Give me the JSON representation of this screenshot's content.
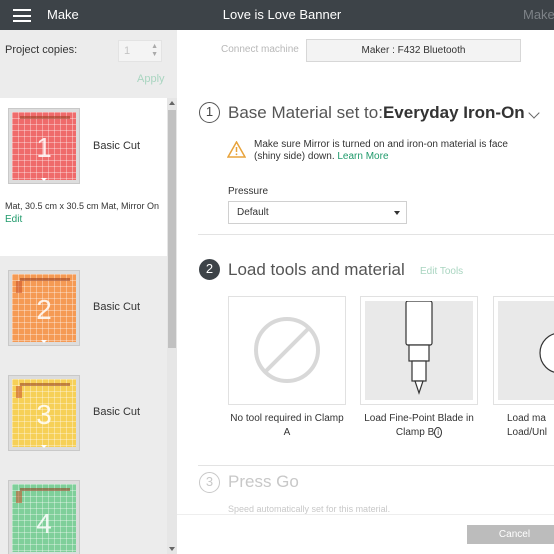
{
  "topbar": {
    "make_label": "Make",
    "title": "Love is Love Banner",
    "right_label": "Maker"
  },
  "sidebar": {
    "copies_label": "Project copies:",
    "copies_value": "1",
    "apply_label": "Apply",
    "mats": [
      {
        "number": "1",
        "color": "#ef6b6b",
        "label": "Basic Cut",
        "desc": "Mat, 30.5 cm x 30.5 cm Mat, Mirror On",
        "edit": "Edit"
      },
      {
        "number": "2",
        "color": "#f59a54",
        "label": "Basic Cut"
      },
      {
        "number": "3",
        "color": "#f6d057",
        "label": "Basic Cut"
      },
      {
        "number": "4",
        "color": "#7fcf9a",
        "label": ""
      }
    ]
  },
  "main": {
    "connect_label": "Connect machine",
    "machine_label": "Maker : F432 Bluetooth",
    "step1": {
      "number": "1",
      "title_prefix": "Base Material set to:",
      "title_material": "Everyday Iron-On"
    },
    "warning": {
      "text": "Make sure Mirror is turned on and iron-on material is face (shiny side) down.",
      "link": "Learn More"
    },
    "pressure": {
      "label": "Pressure",
      "value": "Default"
    },
    "step2": {
      "number": "2",
      "title": "Load tools and material",
      "edit_tools": "Edit Tools"
    },
    "tools": [
      {
        "caption": "No tool required in Clamp A"
      },
      {
        "caption": "Load Fine-Point Blade in Clamp B"
      },
      {
        "caption": "Load ma Load/Unl"
      }
    ],
    "step3": {
      "number": "3",
      "title": "Press Go",
      "desc": "Speed automatically set for this material."
    }
  },
  "footer": {
    "cancel_label": "Cancel"
  },
  "colors": {
    "topbar": "#3d4348",
    "accent": "#1f9a6b",
    "sidebar": "#ececec"
  }
}
